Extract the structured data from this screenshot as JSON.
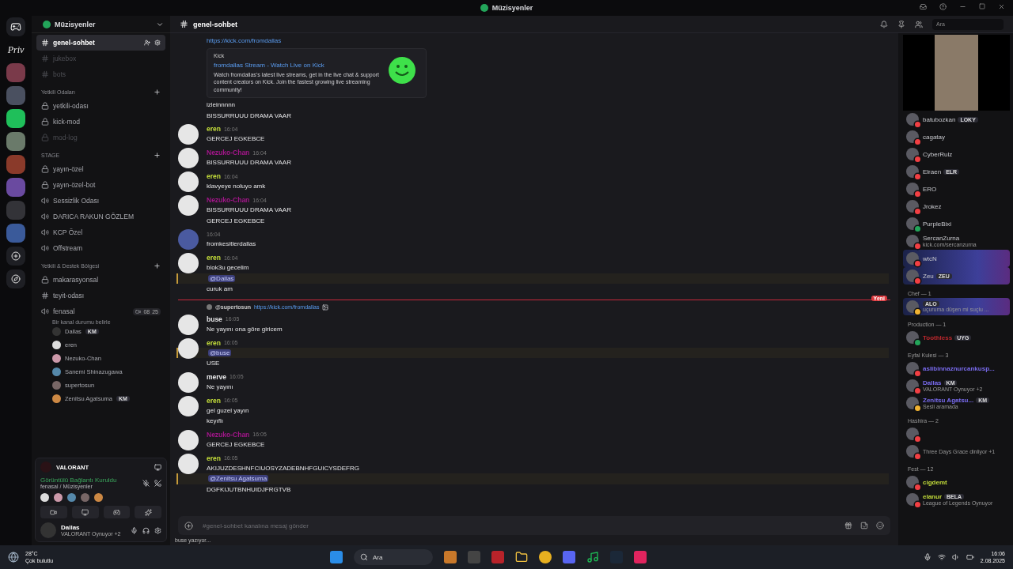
{
  "titlebar": {
    "title": "Müzisyenler"
  },
  "rail": {
    "text_icon": "Priv"
  },
  "server": {
    "name": "Müzisyenler"
  },
  "channel_groups": [
    {
      "channels": [
        {
          "name": "genel-sohbet",
          "kind": "text",
          "selected": true,
          "muted": false
        },
        {
          "name": "jukebox",
          "kind": "text",
          "selected": false,
          "muted": true
        },
        {
          "name": "bots",
          "kind": "text",
          "selected": false,
          "muted": true
        }
      ]
    },
    {
      "name": "Yetkili Odaları",
      "channels": [
        {
          "name": "yetkili-odası",
          "kind": "locked",
          "selected": false,
          "muted": false
        },
        {
          "name": "kick-mod",
          "kind": "locked",
          "selected": false,
          "muted": false
        },
        {
          "name": "mod-log",
          "kind": "locked",
          "selected": false,
          "muted": true
        }
      ]
    },
    {
      "name": "STAGE",
      "channels": [
        {
          "name": "yayın-özel",
          "kind": "locked",
          "selected": false,
          "muted": false
        },
        {
          "name": "yayın-özel-bot",
          "kind": "locked",
          "selected": false,
          "muted": false
        },
        {
          "name": "Sessizlik Odası",
          "kind": "voice",
          "selected": false,
          "muted": false
        },
        {
          "name": "DARICA RAKUN GÖZLEM",
          "kind": "voice",
          "selected": false,
          "muted": false
        },
        {
          "name": "KCP Özel",
          "kind": "voice",
          "selected": false,
          "muted": false
        },
        {
          "name": "Offstream",
          "kind": "voice",
          "selected": false,
          "muted": false
        }
      ]
    },
    {
      "name": "Yetkili & Destek Bölgesi",
      "channels": [
        {
          "name": "makarasyonsal",
          "kind": "locked",
          "selected": false,
          "muted": false
        },
        {
          "name": "teyit-odası",
          "kind": "text",
          "selected": false,
          "muted": false
        },
        {
          "name": "fenasal",
          "kind": "voice",
          "selected": false,
          "muted": false,
          "count_a": "08",
          "count_b": "25",
          "status_hint": "Bir kanal durumu belirle",
          "users": [
            {
              "name": "Dallas",
              "tag": "KM"
            },
            {
              "name": "eren"
            },
            {
              "name": "Nezuko-Chan"
            },
            {
              "name": "Sanemi Shinazugawa"
            },
            {
              "name": "supertosun"
            },
            {
              "name": "Zenitsu Agatsuma",
              "tag": "KM"
            }
          ]
        }
      ]
    }
  ],
  "voice_panel": {
    "game": "VALORANT",
    "status": "Görüntülü Bağlantı Kuruldu",
    "location": "fenasal / Müzisyenler"
  },
  "user": {
    "name": "Dallas",
    "activity": "VALORANT Oynuyor +2"
  },
  "chat": {
    "channel": "genel-sohbet",
    "search_placeholder": "Ara",
    "new_label": "Yeni",
    "input_placeholder": "#genel-sohbet kanalına mesaj gönder",
    "typing": "buse yazıyor...",
    "messages": [
      {
        "lines": [
          {
            "kind": "link",
            "text": "https://kick.com/fromdallas"
          }
        ],
        "embed": {
          "provider": "Kick",
          "title": "fromdallas Stream - Watch Live on Kick",
          "description": "Watch fromdallas's latest live streams, get in the live chat & support content creators on Kick. Join the fastest growing live streaming community!"
        },
        "after": [
          {
            "kind": "text",
            "text": "izleinnnnn"
          },
          {
            "kind": "text",
            "text": "BISSURRUUU DRAMA VAAR"
          }
        ]
      },
      {
        "author": "eren",
        "color": "#c3dc3a",
        "time": "16:04",
        "lines": [
          {
            "kind": "text",
            "text": "GERCEJ EGKEBCE"
          }
        ]
      },
      {
        "author": "Nezuko-Chan",
        "color": "#a3168a",
        "time": "16:04",
        "lines": [
          {
            "kind": "text",
            "text": "BISSURRUUU DRAMA VAAR"
          }
        ]
      },
      {
        "author": "eren",
        "color": "#c3dc3a",
        "time": "16:04",
        "lines": [
          {
            "kind": "text",
            "text": "klavyeye noluyo amk"
          }
        ]
      },
      {
        "author": "Nezuko-Chan",
        "color": "#a3168a",
        "time": "16:04",
        "lines": [
          {
            "kind": "text",
            "text": "BISSURRUUU DRAMA VAAR"
          },
          {
            "kind": "text",
            "text": "GERCEJ EGKEBCE"
          }
        ]
      },
      {
        "time": "16:04",
        "lines": [
          {
            "kind": "text",
            "text": "fromkesitlerdallas"
          }
        ]
      },
      {
        "author": "eren",
        "color": "#c3dc3a",
        "time": "16:04",
        "lines": [
          {
            "kind": "text",
            "text": "blok3u gecelim"
          },
          {
            "kind": "mention",
            "text": "@Dallas"
          },
          {
            "kind": "text",
            "text": "curuk am"
          }
        ]
      },
      {
        "divider": true
      },
      {
        "reply": {
          "user": "@supertosun",
          "link": "https://kick.com/fromdallas"
        },
        "author": "buse",
        "color": "#e8e8ea",
        "time": "16:05",
        "lines": [
          {
            "kind": "text",
            "text": "Ne yayını ona göre giricem"
          }
        ]
      },
      {
        "author": "eren",
        "color": "#c3dc3a",
        "time": "16:05",
        "lines": [
          {
            "kind": "mention",
            "text": "@buse"
          },
          {
            "kind": "text",
            "text": "USE"
          }
        ]
      },
      {
        "author": "merve",
        "color": "#e8e8ea",
        "time": "16:05",
        "lines": [
          {
            "kind": "text",
            "text": "Ne yayını"
          }
        ]
      },
      {
        "author": "eren",
        "color": "#c3dc3a",
        "time": "16:05",
        "lines": [
          {
            "kind": "text",
            "text": "gel guzel yayın"
          },
          {
            "kind": "text",
            "text": "keyıflı"
          }
        ]
      },
      {
        "author": "Nezuko-Chan",
        "color": "#a3168a",
        "time": "16:05",
        "lines": [
          {
            "kind": "text",
            "text": "GERCEJ EGKEBCE"
          }
        ]
      },
      {
        "author": "eren",
        "color": "#c3dc3a",
        "time": "16:05",
        "lines": [
          {
            "kind": "text",
            "text": "AKIJUZDESHNFCIUOSYZADEBNHFGUICYSDEFRG"
          },
          {
            "kind": "mention",
            "text": "@Zenitsu Agatsuma"
          },
          {
            "kind": "text",
            "text": "DGFKIJUTBNHUIDJFRGTVB"
          }
        ]
      }
    ]
  },
  "member_groups": [
    {
      "members": [
        {
          "name": "batubozkan",
          "tag": "LOKY",
          "color": "#f23f43",
          "banner": false
        },
        {
          "name": "cagatay",
          "color": "#f23f43",
          "banner": false
        },
        {
          "name": "CyberRulz",
          "color": "#f23f43",
          "banner": false
        },
        {
          "name": "Elraen",
          "tag": "ELR",
          "color": "#f23f43",
          "banner": false
        },
        {
          "name": "ERO",
          "color": "#f23f43",
          "banner": false
        },
        {
          "name": "Jrokez",
          "color": "#f23f43",
          "banner": false
        },
        {
          "name": "PurpleBixi",
          "color": "#23a55a",
          "banner": false
        },
        {
          "name": "SercanZurna",
          "sub": "kick.com/sercanzurna",
          "color": "#f23f43",
          "banner": false
        },
        {
          "name": "wtcN",
          "color": "#f23f43",
          "banner": true
        },
        {
          "name": "Zeu",
          "tag": "ZEU",
          "color": "#f23f43",
          "banner": true
        }
      ]
    },
    {
      "name": "Chef — 1",
      "members": [
        {
          "tag": "ALO",
          "sub": "uçuruma düşen mi suçlu ...",
          "color": "#f0b232",
          "banner": true
        }
      ]
    },
    {
      "name": "Production — 1",
      "members": [
        {
          "name": {
            "text": "Toothless",
            "color": "#c0282d"
          },
          "tag": "UYG",
          "color": "#23a55a",
          "banner": false
        }
      ]
    },
    {
      "name": "Eyfal Kulesi — 3",
      "members": [
        {
          "name": {
            "text": "aslibinnaznurcankusp...",
            "color": "#7a6cf0"
          },
          "color": "#f23f43",
          "banner": false
        },
        {
          "name": {
            "text": "Dallas",
            "color": "#7a6cf0"
          },
          "tag": "KM",
          "sub": "VALORANT Oynuyor +2",
          "color": "#f23f43",
          "banner": false
        },
        {
          "name": {
            "text": "Zenitsu Agatsu...",
            "color": "#7a6cf0"
          },
          "tag": "KM",
          "sub": "Sesli aramada",
          "color": "#f0b232",
          "banner": false
        }
      ]
    },
    {
      "name": "Hashira — 2",
      "members": [
        {
          "color": "#f23f43",
          "banner": false
        },
        {
          "sub": "Three Days Grace dinliyor +1",
          "color": "#f23f43",
          "banner": false
        }
      ]
    },
    {
      "name": "Fest — 12",
      "members": [
        {
          "name": {
            "text": "cigdemt",
            "color": "#c3dc3a"
          },
          "color": "#f23f43",
          "banner": false
        },
        {
          "name": {
            "text": "elanur",
            "color": "#c3dc3a"
          },
          "tag": "BELA",
          "sub": "League of Legends Oynuyor",
          "color": "#f23f43",
          "banner": false
        }
      ]
    }
  ],
  "taskbar": {
    "temperature": "28°C",
    "weather": "Çok bulutlu",
    "search": "Ara",
    "time": "16:06",
    "date": "2.08.2025"
  }
}
